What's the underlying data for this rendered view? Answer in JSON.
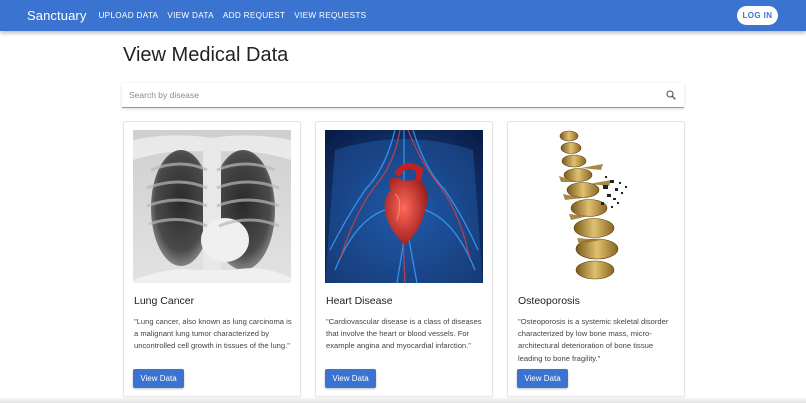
{
  "app": {
    "brand": "Sanctuary",
    "brand_color": "#3b73d0"
  },
  "nav": {
    "items": [
      {
        "label": "UPLOAD DATA"
      },
      {
        "label": "VIEW DATA"
      },
      {
        "label": "ADD REQUEST"
      },
      {
        "label": "VIEW REQUESTS"
      }
    ],
    "login_label": "LOG IN"
  },
  "page": {
    "title": "View Medical Data"
  },
  "search": {
    "placeholder": "Search by disease",
    "value": ""
  },
  "cards": [
    {
      "title": "Lung Cancer",
      "image": "chest-xray-image",
      "description": "\"Lung cancer, also known as lung carcinoma is a malignant lung tumor characterized by uncontrolled cell growth in tissues of the lung.\"",
      "button": "View Data"
    },
    {
      "title": "Heart Disease",
      "image": "anatomical-heart-image",
      "description": "\"Cardiovascular disease is a class of diseases that involve the heart or blood vessels. For example angina and myocardial infarction.\"",
      "button": "View Data"
    },
    {
      "title": "Osteoporosis",
      "image": "spine-vertebrae-image",
      "description": "\"Osteoporosis is a systemic skeletal disorder characterized by low bone mass, micro-architectural deterioration of bone tissue leading to bone fragility.\"",
      "button": "View Data"
    }
  ]
}
